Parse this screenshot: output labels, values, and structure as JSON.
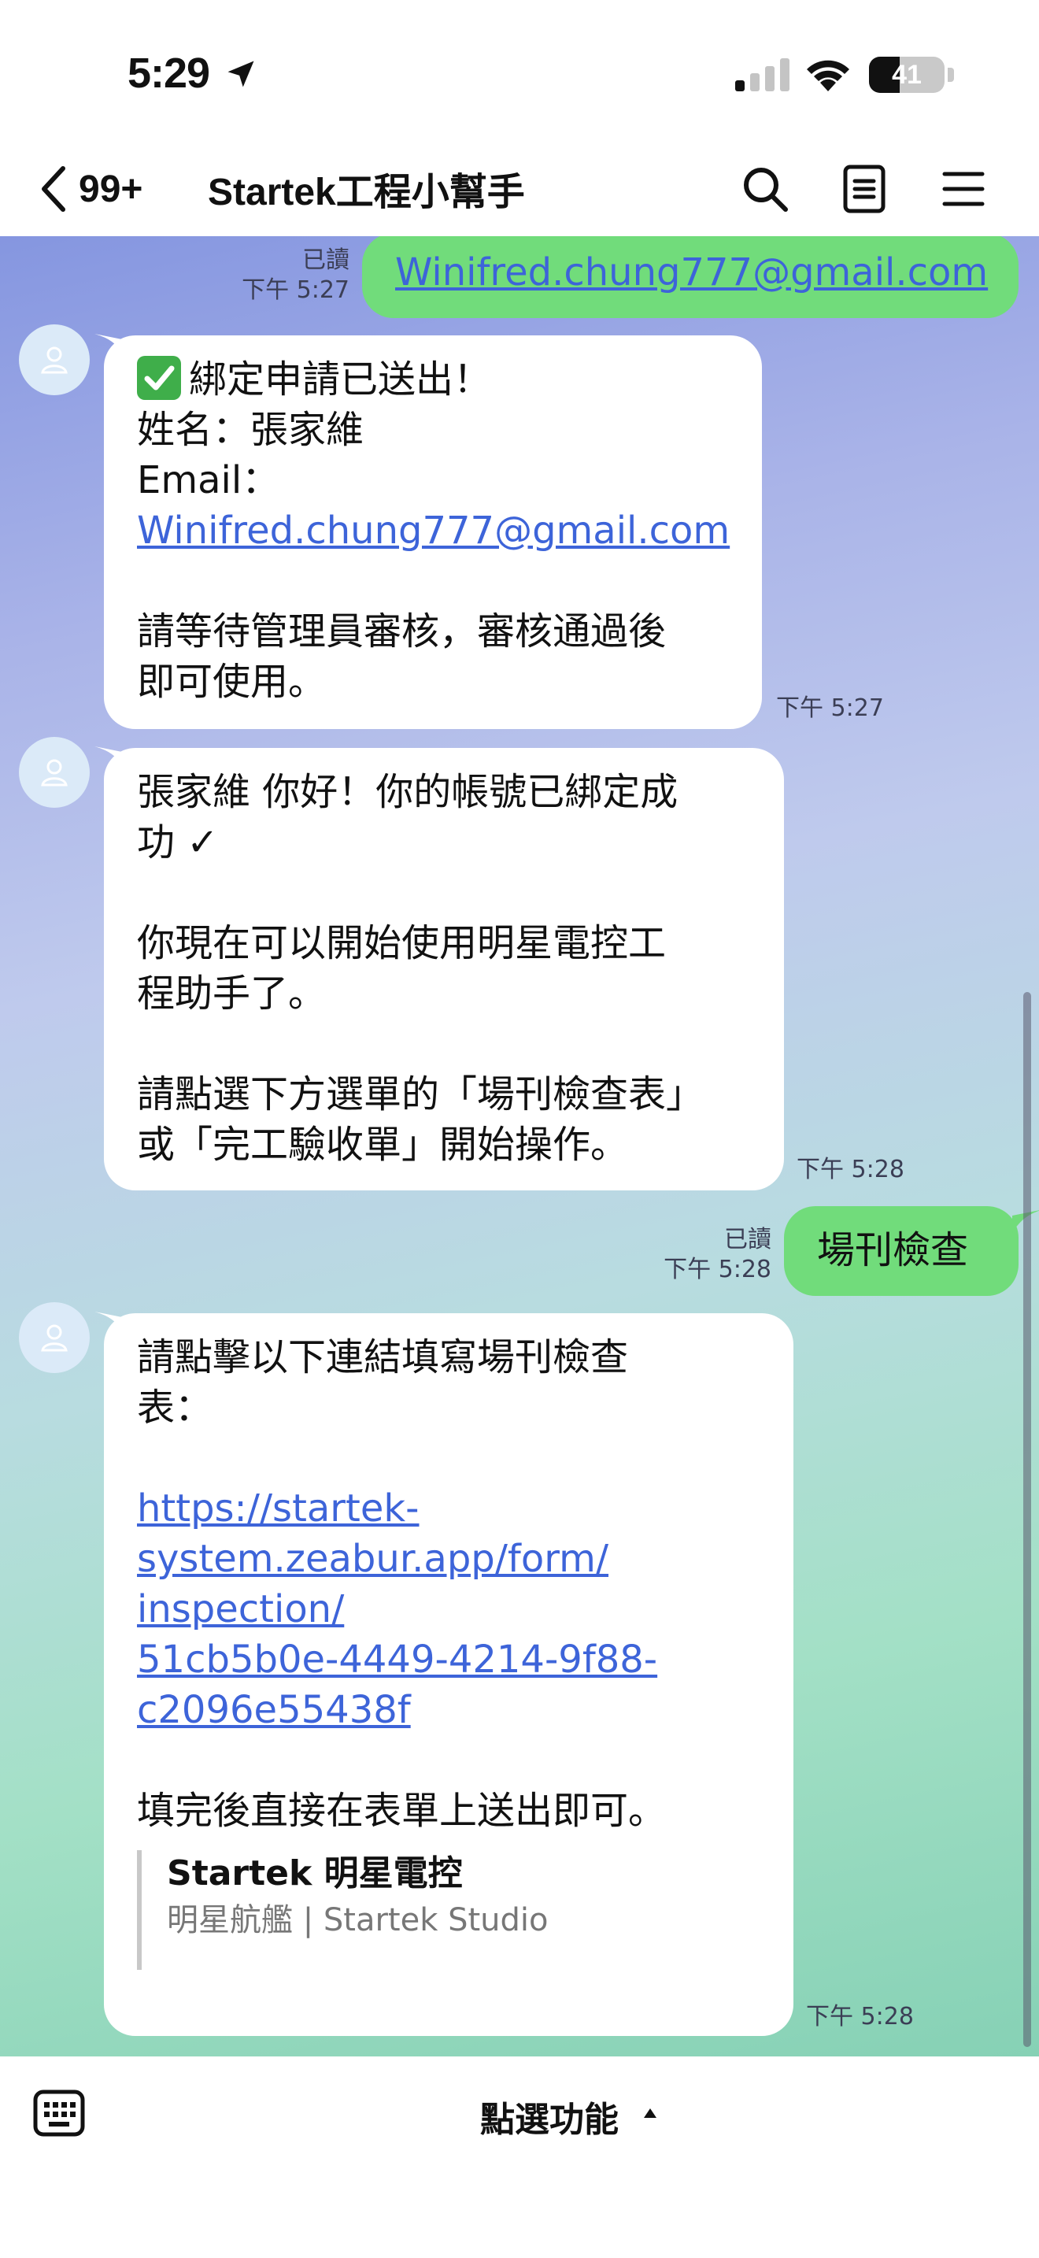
{
  "status_bar": {
    "time": "5:29",
    "battery_level": "41",
    "battery_fraction": 0.41
  },
  "nav": {
    "back_count": "99+",
    "title": "Startek工程小幫手",
    "icons": [
      "search-icon",
      "note-icon",
      "menu-icon"
    ]
  },
  "messages": [
    {
      "direction": "outgoing",
      "read_label": "已讀",
      "time": "下午 5:27",
      "link": "Winifred.chung777@gmail.com"
    },
    {
      "direction": "incoming",
      "time": "下午 5:27",
      "lines": [
        "綁定申請已送出！",
        "姓名：張家維",
        "Email：",
        "Winifred.chung777@gmail.com",
        "",
        "請等待管理員審核，審核通過後",
        "即可使用。"
      ]
    },
    {
      "direction": "incoming",
      "time": "下午 5:28",
      "lines": [
        "張家維 你好！你的帳號已綁定成",
        "功 ✓",
        "",
        "你現在可以開始使用明星電控工",
        "程助手了。",
        "",
        "請點選下方選單的「場刊檢查表」",
        "或「完工驗收單」開始操作。"
      ]
    },
    {
      "direction": "outgoing",
      "read_label": "已讀",
      "time": "下午 5:28",
      "text": "場刊檢查"
    },
    {
      "direction": "incoming",
      "time": "下午 5:28",
      "intro_lines": [
        "請點擊以下連結填寫場刊檢查",
        "表："
      ],
      "link_lines": [
        "https://startek-",
        "system.zeabur.app/form/",
        "inspection/",
        "51cb5b0e-4449-4214-9f88-",
        "c2096e55438f"
      ],
      "outro": "填完後直接在表單上送出即可。",
      "preview": {
        "title": "Startek 明星電控",
        "subtitle": "明星航艦 | Startek Studio"
      }
    }
  ],
  "bottom_bar": {
    "menu_label": "點選功能"
  },
  "colors": {
    "outgoing_bubble": "#71dc7b",
    "incoming_bubble": "#ffffff",
    "link": "#3d64d9",
    "gradient_top": "#8596e0",
    "gradient_bottom": "#86d1b5"
  }
}
